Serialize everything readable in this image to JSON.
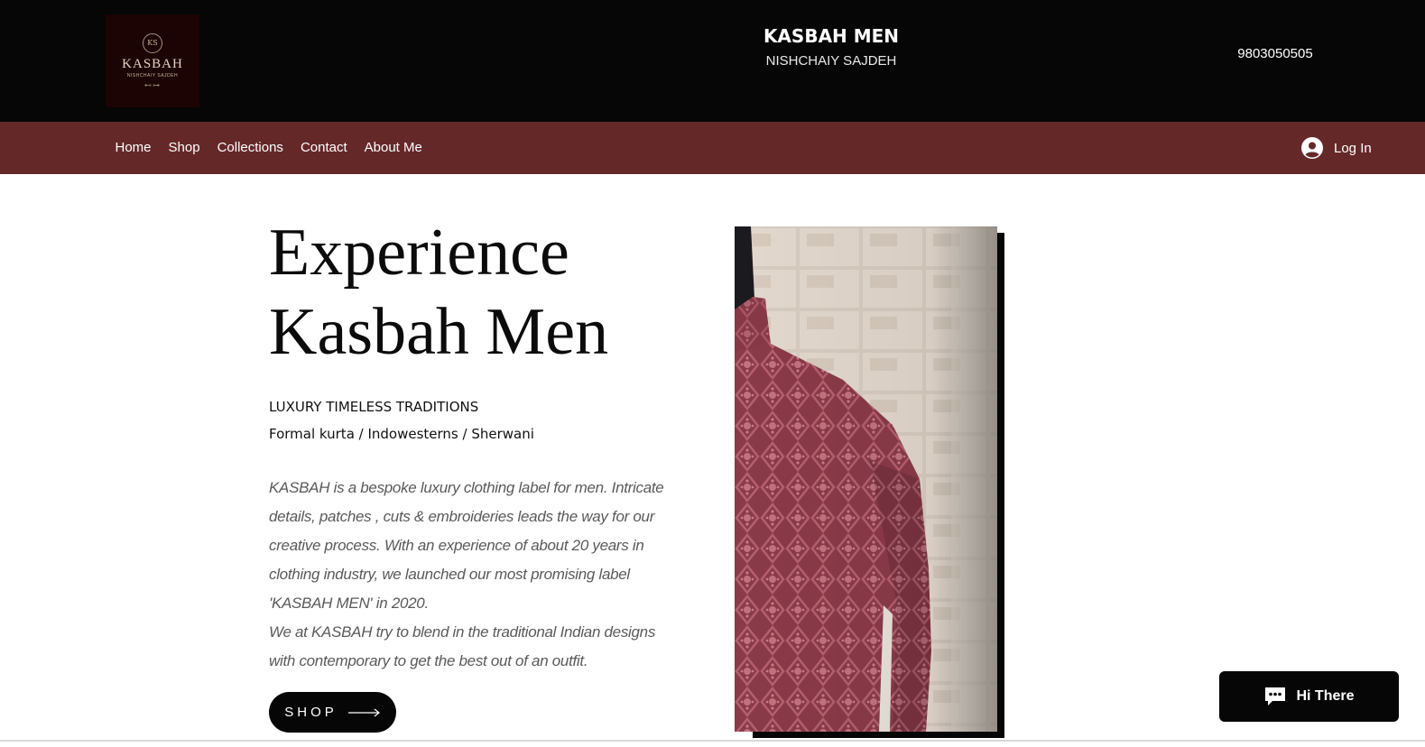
{
  "header": {
    "logo": {
      "monogram": "KS",
      "wordmark": "KASBAH",
      "subline": "NISHCHAIY SAJDEH",
      "icon": "brand-logo"
    },
    "site_title": "KASBAH MEN",
    "site_subtitle": "NISHCHAIY SAJDEH",
    "phone": "9803050505"
  },
  "nav": {
    "items": [
      {
        "label": "Home"
      },
      {
        "label": "Shop"
      },
      {
        "label": "Collections"
      },
      {
        "label": "Contact"
      },
      {
        "label": "About Me"
      }
    ],
    "login": {
      "label": "Log In",
      "icon": "user-avatar-icon"
    }
  },
  "hero": {
    "title_line1": "Experience",
    "title_line2": "Kasbah Men",
    "tagline": "LUXURY TIMELESS TRADITIONS",
    "categories": "Formal kurta / Indowesterns / Sherwani",
    "description_p1": "KASBAH is a bespoke luxury clothing label for men. Intricate details, patches , cuts & embroideries leads the way for our creative process. With an experience of about 20 years in clothing industry, we launched our most promising label 'KASBAH MEN' in 2020.",
    "description_p2": "We at KASBAH try to blend in the traditional Indian designs with contemporary to get the best out of an outfit.",
    "shop_button": {
      "label": "SHOP",
      "icon": "arrow-right-icon"
    }
  },
  "chat": {
    "label": "Hi There",
    "icon": "chat-bubble-icon"
  },
  "colors": {
    "header_bg": "#060606",
    "nav_bg": "#652829",
    "kurta": "#8d3c4a"
  }
}
